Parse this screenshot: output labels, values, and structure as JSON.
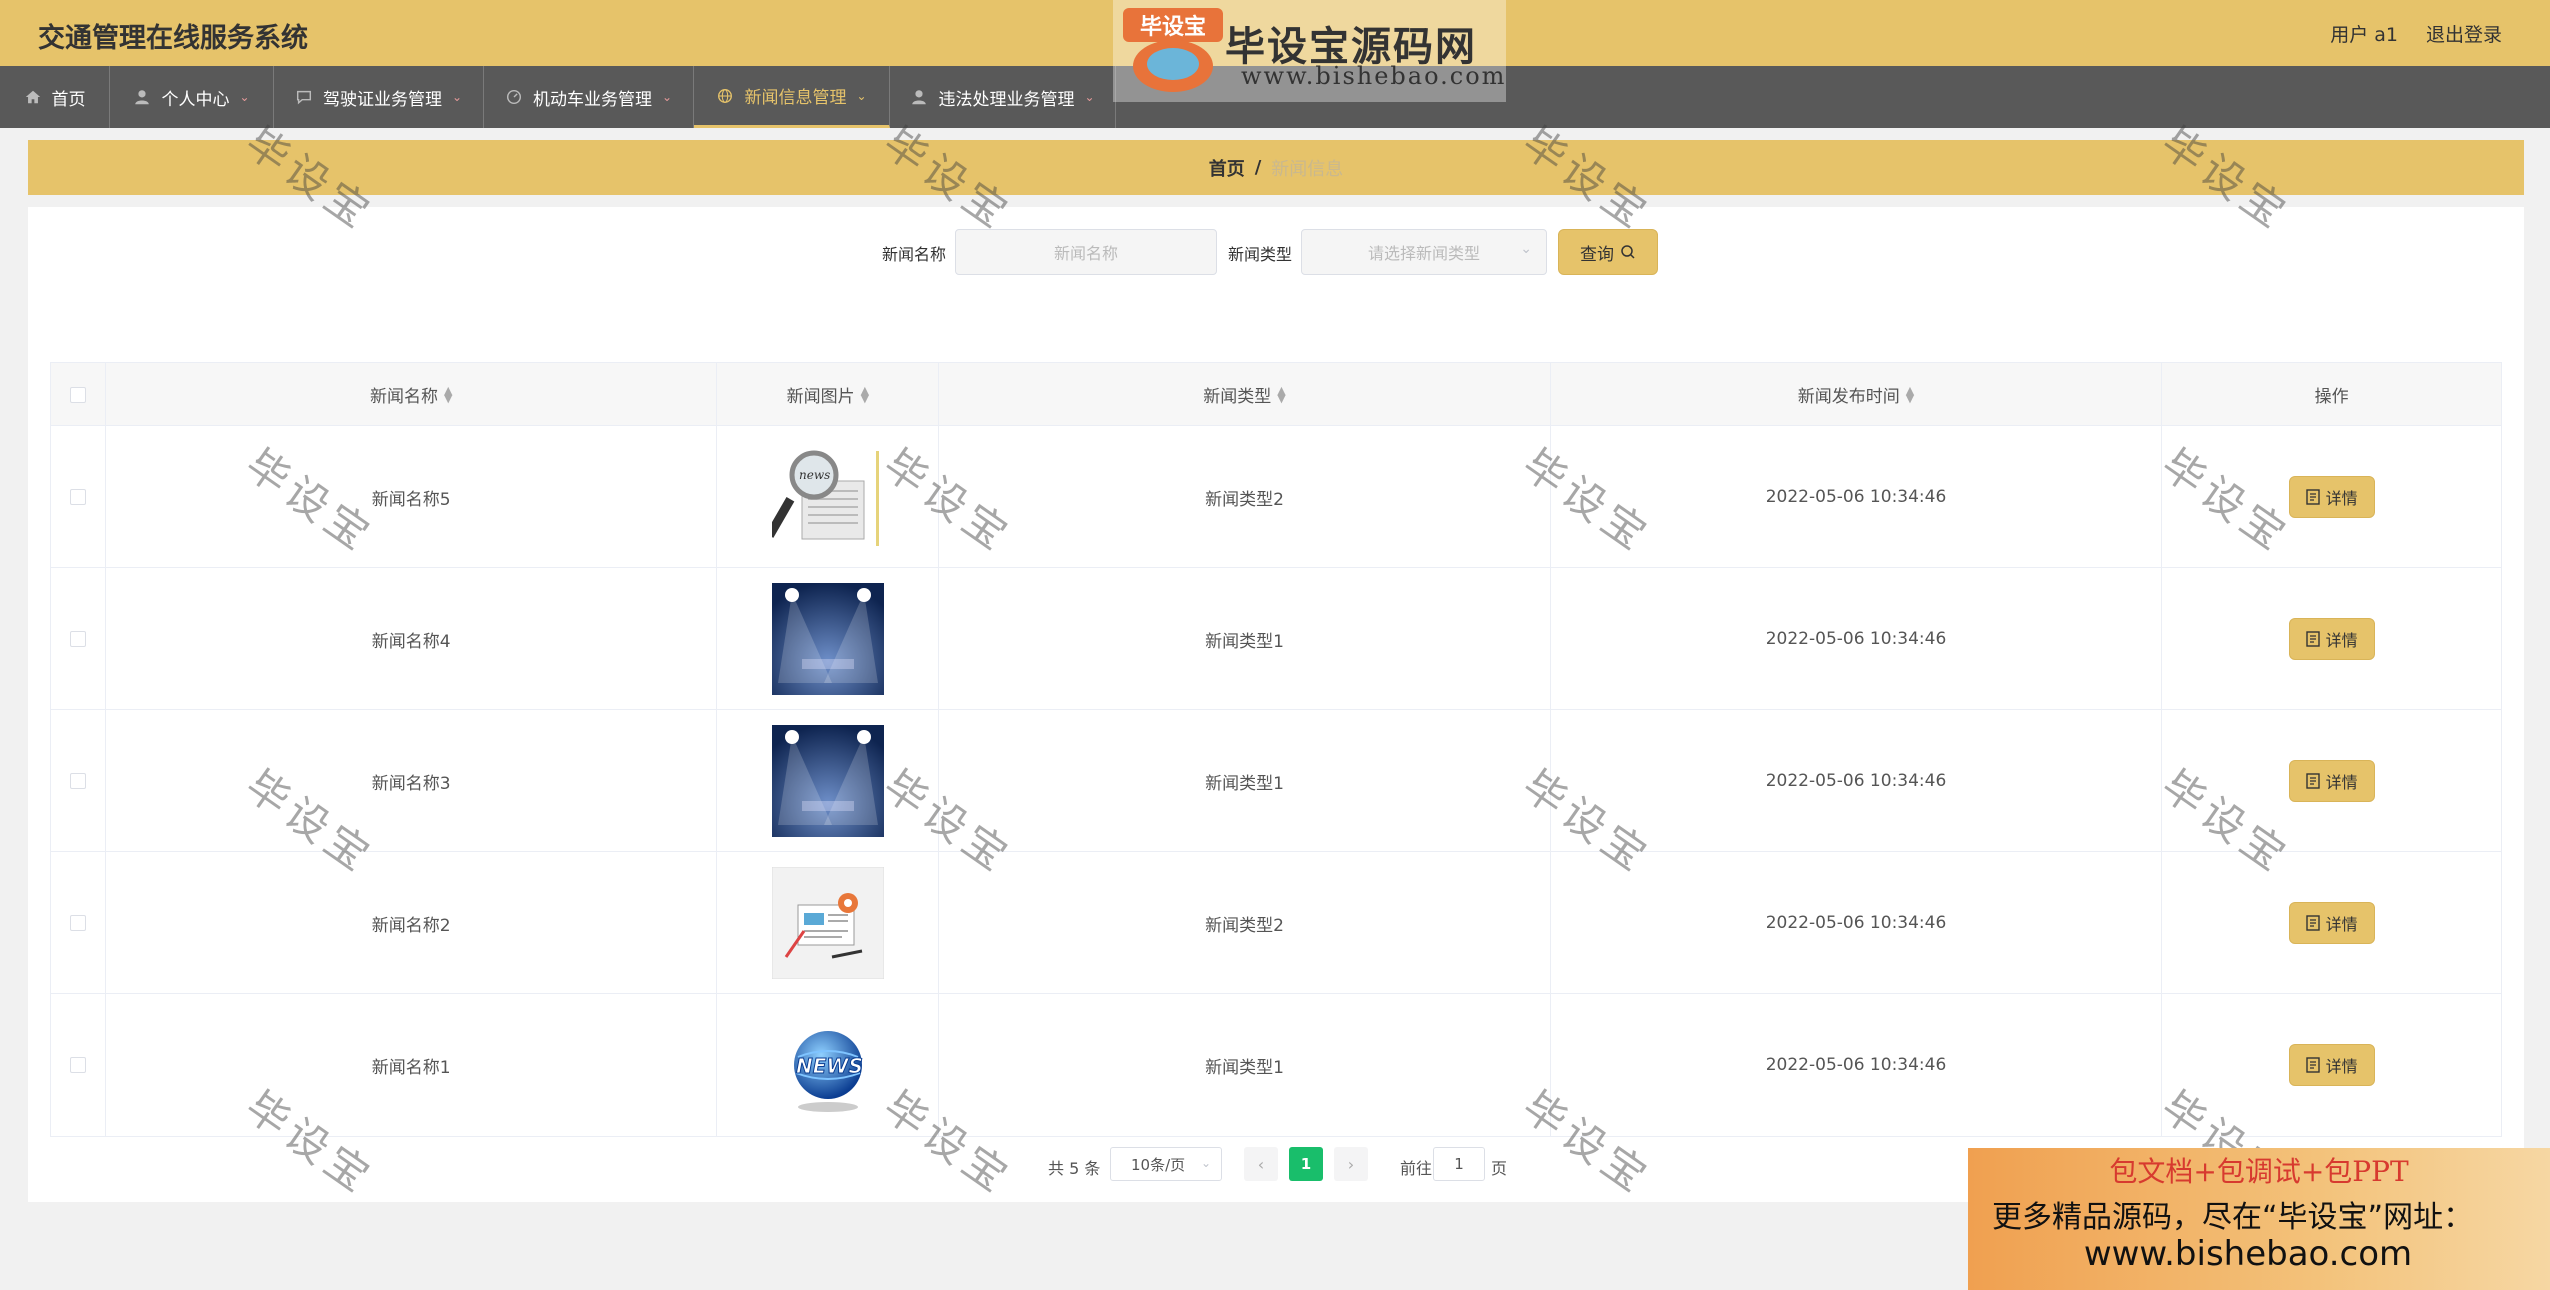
{
  "header": {
    "app_title": "交通管理在线服务系统",
    "user_label": "用户 a1",
    "logout_label": "退出登录"
  },
  "nav": {
    "items": [
      {
        "label": "首页",
        "icon": "home-icon",
        "has_dropdown": false
      },
      {
        "label": "个人中心",
        "icon": "user-icon",
        "has_dropdown": true
      },
      {
        "label": "驾驶证业务管理",
        "icon": "message-icon",
        "has_dropdown": true
      },
      {
        "label": "机动车业务管理",
        "icon": "dashboard-icon",
        "has_dropdown": true
      },
      {
        "label": "新闻信息管理",
        "icon": "globe-icon",
        "has_dropdown": true,
        "active": true
      },
      {
        "label": "违法处理业务管理",
        "icon": "user-icon",
        "has_dropdown": true
      }
    ]
  },
  "breadcrumb": {
    "home": "首页",
    "separator": "/",
    "current": "新闻信息"
  },
  "search": {
    "name_label": "新闻名称",
    "name_placeholder": "新闻名称",
    "type_label": "新闻类型",
    "type_placeholder": "请选择新闻类型",
    "query_label": "查询"
  },
  "table": {
    "headers": [
      "新闻名称",
      "新闻图片",
      "新闻类型",
      "新闻发布时间",
      "操作"
    ],
    "rows": [
      {
        "name": "新闻名称5",
        "image": "magnifier-newspaper",
        "type": "新闻类型2",
        "time": "2022-05-06 10:34:46",
        "action": "详情"
      },
      {
        "name": "新闻名称4",
        "image": "spotlight-stage",
        "type": "新闻类型1",
        "time": "2022-05-06 10:34:46",
        "action": "详情"
      },
      {
        "name": "新闻名称3",
        "image": "spotlight-stage",
        "type": "新闻类型1",
        "time": "2022-05-06 10:34:46",
        "action": "详情"
      },
      {
        "name": "新闻名称2",
        "image": "news-illustration",
        "type": "新闻类型2",
        "time": "2022-05-06 10:34:46",
        "action": "详情"
      },
      {
        "name": "新闻名称1",
        "image": "news-globe",
        "type": "新闻类型1",
        "time": "2022-05-06 10:34:46",
        "action": "详情"
      }
    ]
  },
  "pagination": {
    "total": "共 5 条",
    "page_size": "10条/页",
    "current_page": "1",
    "goto_label": "前往",
    "goto_value": "1",
    "page_suffix": "页"
  },
  "watermark": {
    "logo_badge": "毕设宝",
    "logo_text": "毕设宝源码网",
    "logo_url": "www.bishebao.com",
    "tile_text": "毕设宝",
    "promo_line1": "包文档+包调试+包PPT",
    "promo_line2": "更多精品源码，尽在“毕设宝”网址：",
    "promo_line3": "www.bishebao.com"
  },
  "colors": {
    "accent": "#e6c36a",
    "nav_bg": "#595959",
    "page_active": "#19be6b"
  }
}
